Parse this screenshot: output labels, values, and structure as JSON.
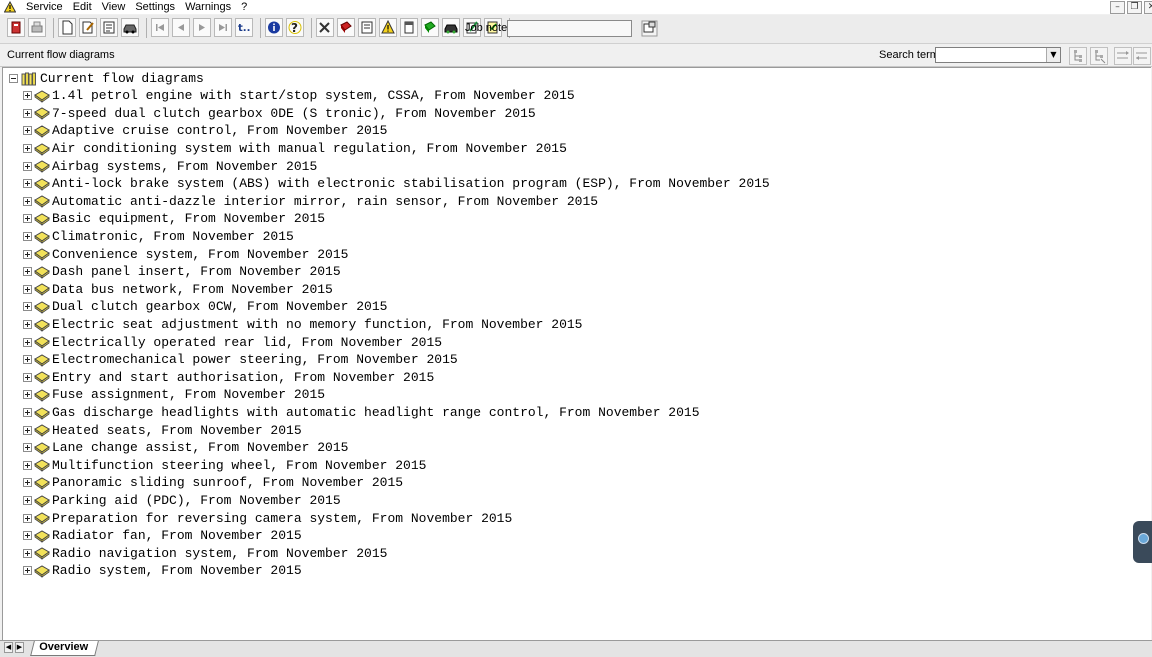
{
  "menubar": {
    "items": [
      "Service",
      "Edit",
      "View",
      "Settings",
      "Warnings",
      "?"
    ]
  },
  "toolbar": {
    "job_note_label": "Job note:",
    "job_note_value": "",
    "icons": [
      "exit-icon",
      "print-icon",
      "new-document-icon",
      "edit-document-icon",
      "report-icon",
      "car-icon",
      "first-icon",
      "previous-icon",
      "next-icon",
      "last-icon",
      "back-to-icon",
      "info-icon",
      "question-help-icon",
      "tools-icon",
      "book-icon",
      "clipboard-icon",
      "warning-icon",
      "notepad-icon",
      "green-book-icon",
      "car-dark-icon",
      "edit-pen-icon",
      "checklist-icon"
    ]
  },
  "flowbar": {
    "title": "Current flow diagrams",
    "search_label": "Search term:",
    "search_value": ""
  },
  "tree": {
    "root_label": "Current flow diagrams",
    "items": [
      "1.4l petrol engine with start/stop system, CSSA, From November 2015",
      "7-speed dual clutch gearbox 0DE (S tronic), From November 2015",
      "Adaptive cruise control, From November 2015",
      "Air conditioning system with manual regulation, From November 2015",
      "Airbag systems, From November 2015",
      "Anti-lock brake system (ABS) with electronic stabilisation program (ESP), From November 2015",
      "Automatic anti-dazzle interior mirror, rain sensor, From November 2015",
      "Basic equipment, From November 2015",
      "Climatronic, From November 2015",
      "Convenience system, From November 2015",
      "Dash panel insert, From November 2015",
      "Data bus network, From November 2015",
      "Dual clutch gearbox 0CW, From November 2015",
      "Electric seat adjustment with no memory function, From November 2015",
      "Electrically operated rear lid, From November 2015",
      "Electromechanical power steering, From November 2015",
      "Entry and start authorisation, From November 2015",
      "Fuse assignment, From November 2015",
      "Gas discharge headlights with automatic headlight range control, From November 2015",
      "Heated seats, From November 2015",
      "Lane change assist, From November 2015",
      "Multifunction steering wheel, From November 2015",
      "Panoramic sliding sunroof, From November 2015",
      "Parking aid (PDC), From November 2015",
      "Preparation for reversing camera system, From November 2015",
      "Radiator fan, From November 2015",
      "Radio navigation system, From November 2015",
      "Radio system, From November 2015"
    ]
  },
  "tabs": {
    "overview_label": "Overview"
  },
  "colors": {
    "book_icon": "#f2e25a",
    "panel_bg": "#ffffff",
    "chrome_bg": "#f0f0f0"
  }
}
